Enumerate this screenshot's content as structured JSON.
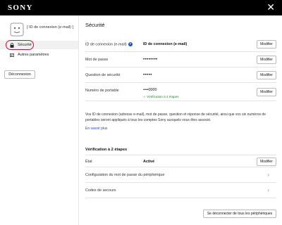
{
  "header": {
    "brand": "SONY",
    "close_icon": "close-icon"
  },
  "sidebar": {
    "user_id": "[ ID de connexion (e-mail) ]",
    "items": [
      {
        "label": "Sécurité",
        "icon": "lock-icon",
        "active": true
      },
      {
        "label": "Autres paramètres",
        "icon": "settings-card-icon",
        "active": false
      }
    ],
    "logout_label": "Déconnexion"
  },
  "main": {
    "title": "Sécurité",
    "rows": [
      {
        "label": "ID de connexion (e-mail)",
        "value": "ID de connexion (e-mail)",
        "button": "Modifier"
      },
      {
        "label": "Mot de passe",
        "value": "••••••••",
        "button": "Modifier"
      },
      {
        "label": "Question de sécurité",
        "value": "•••••",
        "button": "Modifier"
      },
      {
        "label": "Numéro de portable",
        "value": "••••0000",
        "verified": "✓ Vérification à 2 étapes",
        "button": "Modifier"
      }
    ],
    "info_text": "Vos ID de connexion (adresse e-mail), mot de passe, question et réponse de sécurité, ainsi que vos six numéros de portables seront appliqués à tous les comptes Sony auxquels vous êtes associé.",
    "learn_more": "En savoir plus",
    "two_step": {
      "title": "Vérification à 2 étapes",
      "state_label": "État",
      "state_value": "Activé",
      "state_button": "Modifier",
      "links": [
        "Configuration du mot de passe du périphérique",
        "Codes de secours"
      ]
    },
    "disconnect_all": "Se déconnecter de tous les périphériques"
  },
  "colors": {
    "accent": "#1a4fc4",
    "highlight": "#c8102e",
    "verified": "#2e7d32",
    "topbar": "#000000"
  }
}
